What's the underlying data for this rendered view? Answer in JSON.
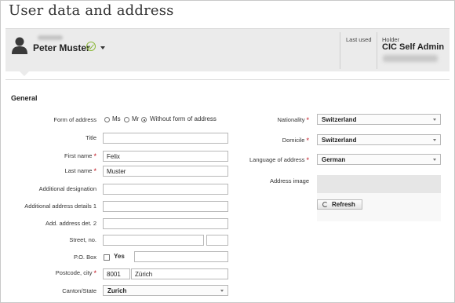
{
  "page": {
    "title": "User data and address"
  },
  "header": {
    "user_name": "Peter Muster",
    "last_used_label": "Last used",
    "holder_label": "Holder",
    "holder_name": "CIC Self Admin"
  },
  "section": {
    "title": "General"
  },
  "form": {
    "form_of_address": {
      "label": "Form of address",
      "options": [
        "Ms",
        "Mr",
        "Without form of address"
      ],
      "selected": "Without form of address"
    },
    "title": {
      "label": "Title",
      "value": ""
    },
    "first_name": {
      "label": "First name",
      "value": "Felix",
      "required": true
    },
    "last_name": {
      "label": "Last name",
      "value": "Muster",
      "required": true
    },
    "additional_designation": {
      "label": "Additional designation",
      "value": ""
    },
    "additional_address_details_1": {
      "label": "Additional address details 1",
      "value": ""
    },
    "add_address_det_2": {
      "label": "Add. address det. 2",
      "value": ""
    },
    "street_no": {
      "label": "Street, no.",
      "street": "",
      "number": ""
    },
    "po_box": {
      "label": "P.O. Box",
      "checkbox_label": "Yes",
      "checked": false,
      "value": ""
    },
    "postcode_city": {
      "label": "Postcode, city",
      "postcode": "8001",
      "city": "Zürich",
      "required": true
    },
    "canton_state": {
      "label": "Canton/State",
      "value": "Zurich"
    },
    "nationality": {
      "label": "Nationality",
      "value": "Switzerland",
      "required": true
    },
    "domicile": {
      "label": "Domicile",
      "value": "Switzerland",
      "required": true
    },
    "language_of_address": {
      "label": "Language of address",
      "value": "German",
      "required": true
    },
    "address_image": {
      "label": "Address image"
    },
    "refresh_button": {
      "label": "Refresh"
    }
  },
  "colors": {
    "required_star": "#c0121e",
    "verified_check": "#8cb83a",
    "header_bg": "#ebebeb"
  }
}
